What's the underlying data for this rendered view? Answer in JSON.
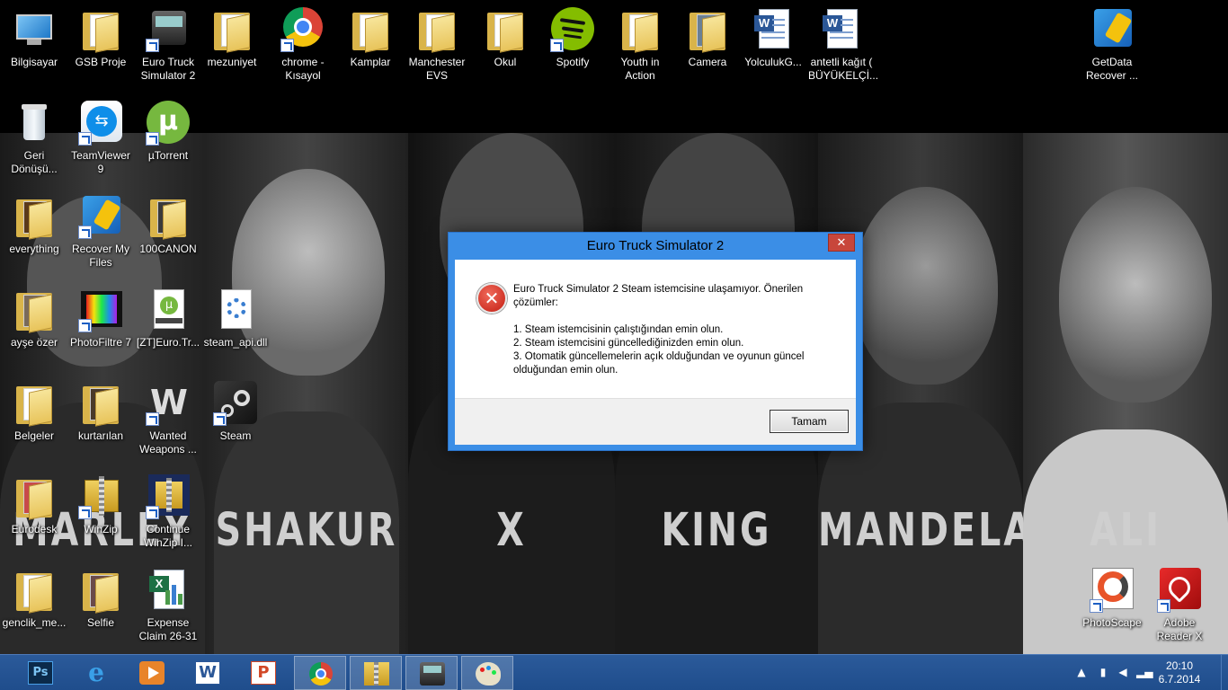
{
  "desktop": {
    "wallpaper_captions": [
      "MARLEY",
      "SHAKUR",
      "X",
      "KING",
      "MANDELA",
      "ALI"
    ],
    "icons": [
      {
        "label": "Bilgisayar",
        "icon": "computer-icon"
      },
      {
        "label": "GSB Proje",
        "icon": "folder-icon"
      },
      {
        "label": "Euro Truck Simulator 2",
        "icon": "truck-icon"
      },
      {
        "label": "mezuniyet",
        "icon": "folder-icon"
      },
      {
        "label": "chrome - Kısayol",
        "icon": "chrome-icon"
      },
      {
        "label": "Kamplar",
        "icon": "folder-icon"
      },
      {
        "label": "Manchester EVS",
        "icon": "folder-icon"
      },
      {
        "label": "Okul",
        "icon": "folder-icon"
      },
      {
        "label": "Spotify",
        "icon": "spotify-icon"
      },
      {
        "label": "Youth in Action",
        "icon": "folder-icon"
      },
      {
        "label": "Camera",
        "icon": "folder-icon"
      },
      {
        "label": "YolculukG...",
        "icon": "word-doc-icon"
      },
      {
        "label": "antetli kağıt ( BÜYÜKELÇİ...",
        "icon": "word-doc-icon"
      },
      {
        "label": "GetData Recover ...",
        "icon": "getdata-icon"
      },
      {
        "label": "Geri Dönüşü...",
        "icon": "recycle-bin-icon"
      },
      {
        "label": "TeamViewer 9",
        "icon": "teamviewer-icon"
      },
      {
        "label": "µTorrent",
        "icon": "utorrent-icon"
      },
      {
        "label": "everything",
        "icon": "folder-icon"
      },
      {
        "label": "Recover My Files",
        "icon": "recover-icon"
      },
      {
        "label": "100CANON",
        "icon": "folder-icon"
      },
      {
        "label": "ayşe özer",
        "icon": "folder-icon"
      },
      {
        "label": "PhotoFiltre 7",
        "icon": "photofiltre-icon"
      },
      {
        "label": "[ZT]Euro.Tr...",
        "icon": "torrent-file-icon"
      },
      {
        "label": "steam_api.dll",
        "icon": "dll-file-icon"
      },
      {
        "label": "Belgeler",
        "icon": "folder-icon"
      },
      {
        "label": "kurtarılan",
        "icon": "folder-icon"
      },
      {
        "label": "Wanted Weapons ...",
        "icon": "wanted-icon"
      },
      {
        "label": "Steam",
        "icon": "steam-icon"
      },
      {
        "label": "Eurodesk",
        "icon": "folder-icon"
      },
      {
        "label": "WinZip",
        "icon": "winzip-icon"
      },
      {
        "label": "Continue WinZip I...",
        "icon": "winzip-icon"
      },
      {
        "label": "genclik_me...",
        "icon": "folder-icon"
      },
      {
        "label": "Selfie",
        "icon": "folder-icon"
      },
      {
        "label": "Expense Claim 26-31",
        "icon": "excel-icon"
      },
      {
        "label": "PhotoScape",
        "icon": "photoscape-icon"
      },
      {
        "label": "Adobe Reader X",
        "icon": "adobe-reader-icon"
      }
    ]
  },
  "dialog": {
    "title": "Euro Truck Simulator 2",
    "close_glyph": "✕",
    "message_intro": "Euro Truck Simulator 2 Steam istemcisine ulaşamıyor. Önerilen çözümler:",
    "suggestions": [
      "1. Steam istemcisinin çalıştığından emin olun.",
      "2. Steam istemcisini güncellediğinizden emin olun.",
      "3. Otomatik güncellemelerin açık olduğundan ve oyunun güncel olduğundan emin olun."
    ],
    "ok_label": "Tamam"
  },
  "taskbar": {
    "items": [
      {
        "icon": "photoshop-icon",
        "text": "Ps"
      },
      {
        "icon": "internet-explorer-icon",
        "text": "e"
      },
      {
        "icon": "media-player-icon",
        "text": ""
      },
      {
        "icon": "word-icon",
        "text": "W"
      },
      {
        "icon": "powerpoint-icon",
        "text": "P"
      },
      {
        "icon": "chrome-icon",
        "text": ""
      },
      {
        "icon": "winzip-icon",
        "text": ""
      },
      {
        "icon": "truck-icon",
        "text": ""
      },
      {
        "icon": "paint-icon",
        "text": ""
      }
    ],
    "clock_time": "20:10",
    "clock_date": "6.7.2014"
  },
  "colors": {
    "taskbar": "#1f4d8c",
    "dialog_frame": "#3b8ee6",
    "close_button": "#c8463b",
    "error_icon": "#c31d12",
    "folder": "#e8c45b"
  }
}
